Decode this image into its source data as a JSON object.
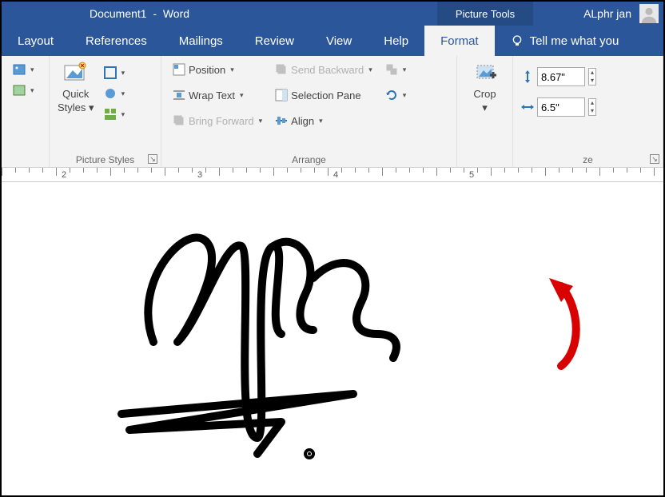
{
  "title": {
    "doc": "Document1",
    "app": "Word",
    "picture_tools": "Picture Tools",
    "user": "ALphr jan"
  },
  "tabs": {
    "layout": "Layout",
    "references": "References",
    "mailings": "Mailings",
    "review": "Review",
    "view": "View",
    "help": "Help",
    "format": "Format",
    "tellme": "Tell me what you"
  },
  "ribbon": {
    "picture_styles": {
      "quick_styles": "Quick",
      "styles": "Styles",
      "group": "Picture Styles"
    },
    "arrange": {
      "position": "Position",
      "wrap_text": "Wrap Text",
      "bring_forward": "Bring Forward",
      "send_backward": "Send Backward",
      "selection_pane": "Selection Pane",
      "align": "Align",
      "group": "Arrange"
    },
    "crop": {
      "label": "Crop"
    },
    "size": {
      "height": "8.67\"",
      "width": "6.5\"",
      "group": "ze"
    }
  },
  "ruler": {
    "marks": [
      "2",
      "3",
      "4",
      "5"
    ]
  }
}
